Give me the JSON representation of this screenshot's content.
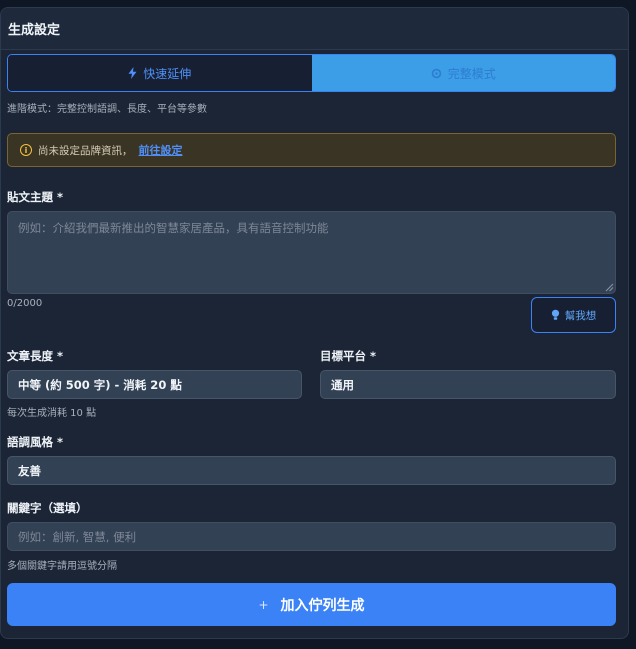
{
  "panel": {
    "title": "生成設定"
  },
  "mode": {
    "quick_label": "快速延伸",
    "advanced_label": "完整模式",
    "hint": "進階模式：完整控制語調、長度、平台等參數"
  },
  "warning": {
    "text": "尚未設定品牌資訊，",
    "link": "前往設定"
  },
  "topic": {
    "label": "貼文主題 *",
    "placeholder": "例如：介紹我們最新推出的智慧家居產品，具有語音控制功能",
    "value": "",
    "counter": "0/2000",
    "help_button": "幫我想"
  },
  "length": {
    "label": "文章長度 *",
    "selected": "中等 (約 500 字) - 消耗 20 點",
    "note": "每次生成消耗 10 點"
  },
  "platform": {
    "label": "目標平台 *",
    "selected": "通用"
  },
  "tone": {
    "label": "語調風格 *",
    "selected": "友善"
  },
  "keywords": {
    "label": "關鍵字（選填）",
    "placeholder": "例如：創新, 智慧, 便利",
    "value": "",
    "note": "多個關鍵字請用逗號分隔"
  },
  "submit": {
    "label": "加入佇列生成"
  },
  "colors": {
    "accent": "#3b82f6",
    "warning": "#f5c040",
    "surface": "#334155"
  }
}
